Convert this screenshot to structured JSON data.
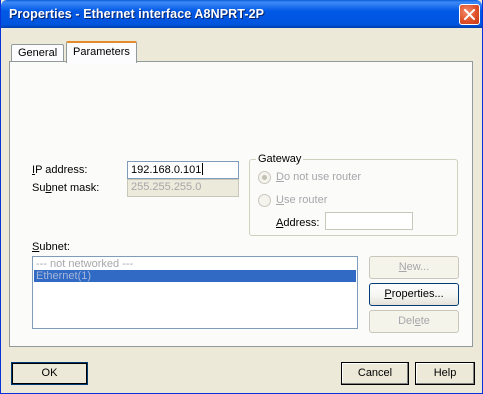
{
  "window": {
    "title": "Properties - Ethernet interface  A8NPRT-2P"
  },
  "tabs": [
    {
      "label": "General",
      "active": false
    },
    {
      "label": "Parameters",
      "active": true
    }
  ],
  "parameters": {
    "ip_address": {
      "label_prefix": "I",
      "label_rest": "P address:",
      "value": "192.168.0.101"
    },
    "subnet_mask": {
      "label_prefix": "Su",
      "label_underline": "b",
      "label_rest": "net mask:",
      "value": "255.255.255.0"
    },
    "gateway": {
      "title": "Gateway",
      "option_no_router": {
        "underline": "D",
        "rest": "o not use router",
        "selected": true
      },
      "option_use_router": {
        "underline": "U",
        "rest": "se router",
        "selected": false
      },
      "address": {
        "underline": "A",
        "rest": "ddress:",
        "value": ""
      }
    },
    "subnet": {
      "label_underline": "S",
      "label_rest": "ubnet:",
      "items": [
        {
          "label": "--- not networked ---",
          "selected": false
        },
        {
          "label": "Ethernet(1)",
          "selected": true
        }
      ]
    },
    "buttons": {
      "new": {
        "underline": "N",
        "rest": "ew...",
        "enabled": false
      },
      "properties": {
        "underline": "P",
        "rest": "roperties...",
        "enabled": true
      },
      "delete": {
        "prefix": "Del",
        "underline": "e",
        "rest": "te",
        "enabled": false
      }
    }
  },
  "footer": {
    "ok": "OK",
    "cancel": "Cancel",
    "help": "Help"
  },
  "colors": {
    "titlebar": "#0055dd",
    "selection": "#316ac5",
    "dialog_bg": "#ece9d8"
  }
}
